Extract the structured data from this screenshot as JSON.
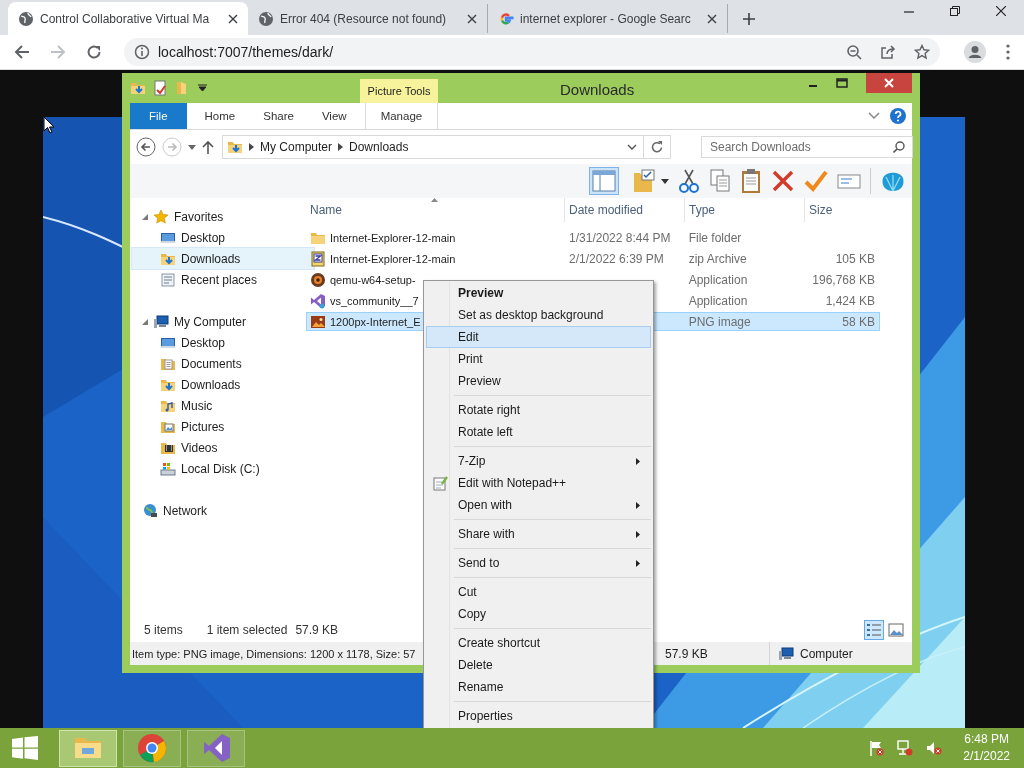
{
  "browser": {
    "tabs": [
      {
        "title": "Control Collaborative Virtual Ma",
        "selected": true
      },
      {
        "title": "Error 404 (Resource not found)",
        "selected": false
      },
      {
        "title": "internet explorer - Google Searc",
        "selected": false
      }
    ],
    "address": "localhost:7007/themes/dark/"
  },
  "explorer": {
    "title": "Downloads",
    "contextual_group": "Picture Tools",
    "ribbon_tabs": [
      {
        "label": "File",
        "kind": "file",
        "selected": false
      },
      {
        "label": "Home",
        "kind": "tab",
        "selected": false
      },
      {
        "label": "Share",
        "kind": "tab",
        "selected": false
      },
      {
        "label": "View",
        "kind": "tab",
        "selected": false
      },
      {
        "label": "Manage",
        "kind": "contextual",
        "selected": false
      }
    ],
    "breadcrumb": [
      "My Computer",
      "Downloads"
    ],
    "search": {
      "placeholder": "Search Downloads"
    },
    "navigation": [
      {
        "label": "Favorites",
        "expanded": true,
        "selected": false,
        "children": [
          {
            "label": "Desktop",
            "selected": false
          },
          {
            "label": "Downloads",
            "selected": true
          },
          {
            "label": "Recent places",
            "selected": false
          }
        ]
      },
      {
        "label": "My Computer",
        "expanded": true,
        "selected": false,
        "children": [
          {
            "label": "Desktop",
            "selected": false
          },
          {
            "label": "Documents",
            "selected": false
          },
          {
            "label": "Downloads",
            "selected": false
          },
          {
            "label": "Music",
            "selected": false
          },
          {
            "label": "Pictures",
            "selected": false
          },
          {
            "label": "Videos",
            "selected": false
          },
          {
            "label": "Local Disk (C:)",
            "selected": false
          }
        ]
      },
      {
        "label": "Network",
        "selected": false
      }
    ],
    "columns": [
      "Name",
      "Date modified",
      "Type",
      "Size"
    ],
    "files": [
      {
        "name": "Internet-Explorer-12-main",
        "date": "1/31/2022 8:44 PM",
        "type": "File folder",
        "selected": false
      },
      {
        "name": "Internet-Explorer-12-main",
        "date": "2/1/2022 6:39 PM",
        "type": "zip Archive",
        "size": "105 KB",
        "selected": false
      },
      {
        "name": "qemu-w64-setup-",
        "type": "Application",
        "size": "196,768 KB",
        "selected": false
      },
      {
        "name": "vs_community__7",
        "type": "Application",
        "size": "1,424 KB",
        "selected": false
      },
      {
        "name": "1200px-Internet_E",
        "type": "PNG image",
        "size": "58 KB",
        "selected": true
      }
    ],
    "status": {
      "items": "5 items",
      "selection": "1 item selected",
      "selection_size": "57.9 KB"
    },
    "view_buttons": [
      {
        "kind": "details",
        "selected": true
      },
      {
        "kind": "thumbnails",
        "selected": false
      }
    ],
    "details_bar": {
      "info": "Item type: PNG image, Dimensions: 1200 x 1178, Size: 57",
      "size": "57.9 KB",
      "zone": "Computer"
    }
  },
  "context_menu": [
    {
      "kind": "item",
      "label": "Preview",
      "default": true,
      "selected": false,
      "submenu": false,
      "icon": false
    },
    {
      "kind": "item",
      "label": "Set as desktop background",
      "default": false,
      "selected": false,
      "submenu": false,
      "icon": false
    },
    {
      "kind": "item",
      "label": "Edit",
      "default": false,
      "selected": true,
      "submenu": false,
      "icon": false
    },
    {
      "kind": "item",
      "label": "Print",
      "default": false,
      "selected": false,
      "submenu": false,
      "icon": false
    },
    {
      "kind": "item",
      "label": "Preview",
      "default": false,
      "selected": false,
      "submenu": false,
      "icon": false
    },
    {
      "kind": "separator"
    },
    {
      "kind": "item",
      "label": "Rotate right",
      "default": false,
      "selected": false,
      "submenu": false,
      "icon": false
    },
    {
      "kind": "item",
      "label": "Rotate left",
      "default": false,
      "selected": false,
      "submenu": false,
      "icon": false
    },
    {
      "kind": "separator"
    },
    {
      "kind": "item",
      "label": "7-Zip",
      "default": false,
      "selected": false,
      "submenu": true,
      "icon": false
    },
    {
      "kind": "item",
      "label": "Edit with Notepad++",
      "default": false,
      "selected": false,
      "submenu": false,
      "icon": true
    },
    {
      "kind": "item",
      "label": "Open with",
      "default": false,
      "selected": false,
      "submenu": true,
      "icon": false
    },
    {
      "kind": "separator"
    },
    {
      "kind": "item",
      "label": "Share with",
      "default": false,
      "selected": false,
      "submenu": true,
      "icon": false
    },
    {
      "kind": "separator"
    },
    {
      "kind": "item",
      "label": "Send to",
      "default": false,
      "selected": false,
      "submenu": true,
      "icon": false
    },
    {
      "kind": "separator"
    },
    {
      "kind": "item",
      "label": "Cut",
      "default": false,
      "selected": false,
      "submenu": false,
      "icon": false
    },
    {
      "kind": "item",
      "label": "Copy",
      "default": false,
      "selected": false,
      "submenu": false,
      "icon": false
    },
    {
      "kind": "separator"
    },
    {
      "kind": "item",
      "label": "Create shortcut",
      "default": false,
      "selected": false,
      "submenu": false,
      "icon": false
    },
    {
      "kind": "item",
      "label": "Delete",
      "default": false,
      "selected": false,
      "submenu": false,
      "icon": false
    },
    {
      "kind": "item",
      "label": "Rename",
      "default": false,
      "selected": false,
      "submenu": false,
      "icon": false
    },
    {
      "kind": "separator"
    },
    {
      "kind": "item",
      "label": "Properties",
      "default": false,
      "selected": false,
      "submenu": false,
      "icon": false
    }
  ],
  "taskbar": {
    "apps": [
      {
        "kind": "explorer",
        "selected": true
      },
      {
        "kind": "chrome",
        "selected": false
      },
      {
        "kind": "visual-studio",
        "selected": false
      }
    ],
    "time": "6:48 PM",
    "date": "2/1/2022"
  }
}
